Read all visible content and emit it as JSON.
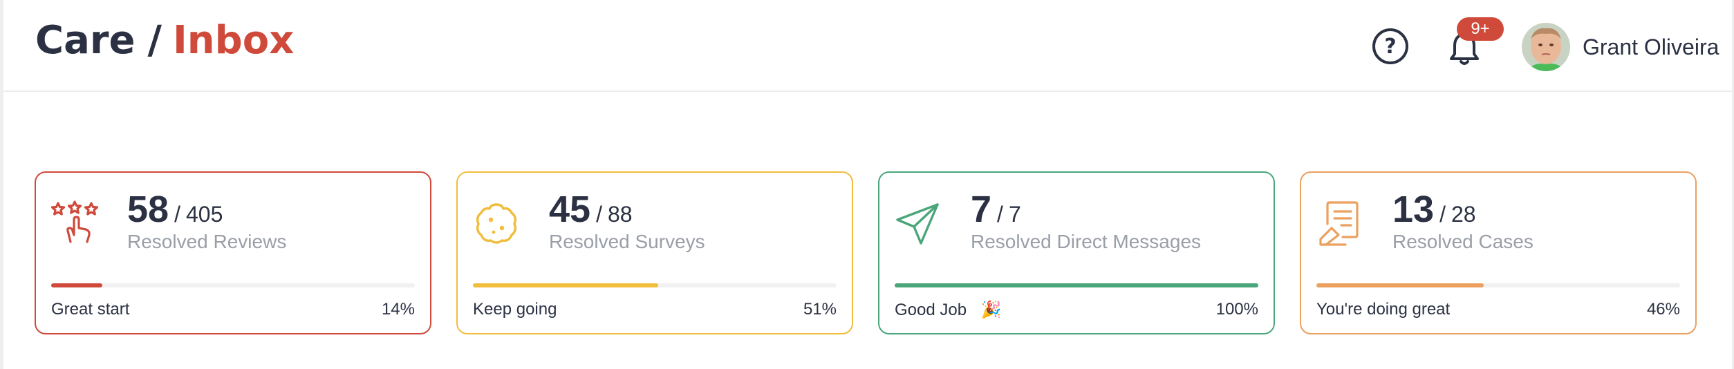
{
  "header": {
    "breadcrumb_root": "Care",
    "breadcrumb_separator": "/",
    "breadcrumb_current": "Inbox",
    "help_icon": "question-circle-icon",
    "help_glyph": "?",
    "notifications_icon": "bell-icon",
    "notification_badge": "9+",
    "user_name": "Grant Oliveira"
  },
  "colors": {
    "brand_accent": "#cf4a3a",
    "text_dark": "#2b3142",
    "text_muted": "#9a9ea7",
    "reviews": "#cf4a3a",
    "surveys": "#f0bd3c",
    "messages": "#4aa67a",
    "cases": "#eba05e"
  },
  "cards": [
    {
      "icon": "star-rating-hand-icon",
      "count": "58",
      "separator": "/",
      "total": "405",
      "label": "Resolved Reviews",
      "progress": 0.14,
      "message": "Great start",
      "percent": "14%",
      "color": "#cf4a3a"
    },
    {
      "icon": "cookie-icon",
      "count": "45",
      "separator": "/",
      "total": "88",
      "label": "Resolved Surveys",
      "progress": 0.51,
      "message": "Keep going",
      "percent": "51%",
      "color": "#f0bd3c"
    },
    {
      "icon": "paper-plane-icon",
      "count": "7",
      "separator": "/",
      "total": "7",
      "label": "Resolved Direct Messages",
      "progress": 1.0,
      "message": "Good Job",
      "emoji": "🎉",
      "percent": "100%",
      "color": "#4aa67a"
    },
    {
      "icon": "case-document-icon",
      "count": "13",
      "separator": "/",
      "total": "28",
      "label": "Resolved Cases",
      "progress": 0.46,
      "message": "You're doing great",
      "percent": "46%",
      "color": "#eba05e"
    }
  ]
}
